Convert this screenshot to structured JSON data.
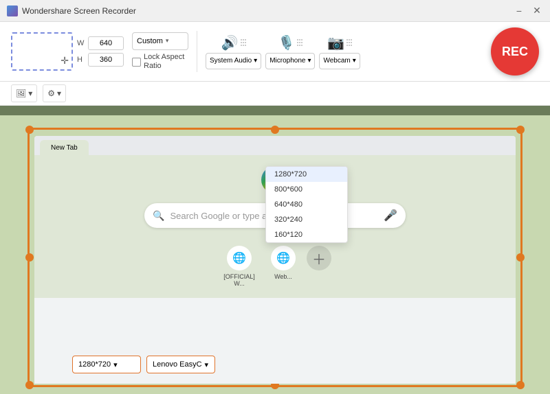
{
  "titleBar": {
    "title": "Wondershare Screen Recorder",
    "minimizeLabel": "−",
    "closeLabel": "✕"
  },
  "controls": {
    "width": "640",
    "height": "360",
    "customLabel": "Custom",
    "lockAspectRatioLabel": "Lock Aspect Ratio",
    "systemAudioLabel": "System Audio",
    "microphoneLabel": "Microphone",
    "webcamLabel": "Webcam",
    "recLabel": "REC"
  },
  "toolbar": {
    "screenshotBtn": "📷",
    "settingsBtn": "⚙"
  },
  "browser": {
    "searchPlaceholder": "Search Google or type a URL",
    "shortcuts": [
      {
        "label": "[OFFICIAL] W...",
        "icon": "🌐"
      },
      {
        "label": "Web...",
        "icon": "🌐"
      }
    ]
  },
  "resolutionDropdown": {
    "selected": "1280*720",
    "options": [
      "1280*720",
      "800*600",
      "640*480",
      "320*240",
      "160*120"
    ]
  },
  "lenovoDropdown": {
    "selected": "Lenovo EasyC",
    "options": [
      "Lenovo EasyC"
    ]
  },
  "icons": {
    "chevronDown": "▾",
    "searchIcon": "🔍",
    "micIcon": "🎤"
  }
}
